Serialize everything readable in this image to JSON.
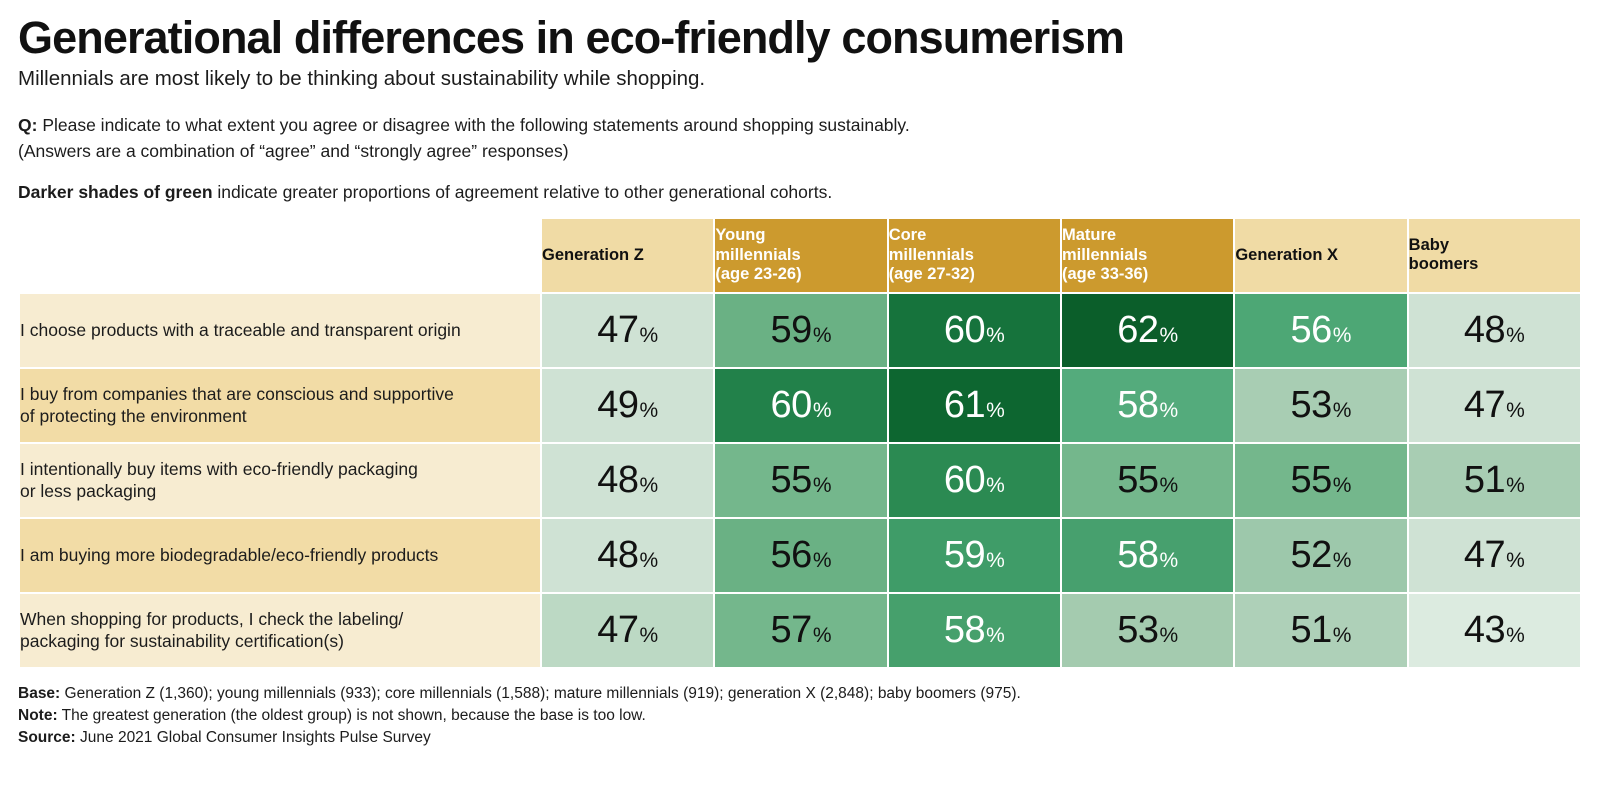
{
  "header": {
    "title": "Generational differences in eco-friendly consumerism",
    "subtitle": "Millennials are most likely to be thinking about sustainability while shopping.",
    "question_label": "Q:",
    "question_text": " Please indicate to what extent you agree or disagree with the following statements around shopping sustainably.",
    "question_note": "(Answers are a combination of “agree” and “strongly agree” responses)",
    "legend_bold": "Darker shades of green",
    "legend_rest": " indicate greater proportions of agreement relative to other generational cohorts."
  },
  "footer": {
    "base_label": "Base:",
    "base_text": " Generation Z (1,360); young millennials (933); core millennials (1,588); mature millennials (919); generation X (2,848); baby boomers (975).",
    "note_label": "Note:",
    "note_text": " The greatest generation (the oldest group) is not shown, because the base is too low.",
    "source_label": "Source:",
    "source_text": " June 2021 Global Consumer Insights Pulse Survey"
  },
  "colors": {
    "header_cream": "#f0dba5",
    "header_gold": "#cc9a2e",
    "label_odd": "#f7ecd1",
    "label_even": "#f2dca6",
    "green_1": "#dfeade",
    "green_2": "#cfe2d4",
    "green_3": "#bcd9c4",
    "green_4": "#a8cdb3",
    "green_5": "#8cc1a0",
    "green_6": "#6ab184",
    "green_7": "#46a06c",
    "green_8": "#2b8a52",
    "green_9": "#16733c",
    "green_10": "#0b5e2a"
  },
  "chart_data": {
    "type": "heatmap",
    "title": "Generational differences in eco-friendly consumerism",
    "subtitle": "Millennials are most likely to be thinking about sustainability while shopping.",
    "xlabel": "",
    "ylabel": "",
    "unit": "%",
    "legend": "Darker shades of green indicate greater proportions of agreement relative to other generational cohorts.",
    "categories": [
      {
        "line1": "Generation Z",
        "line2": "",
        "line3": "",
        "style": "cream"
      },
      {
        "line1": "Young",
        "line2": "millennials",
        "line3": "(age 23-26)",
        "style": "gold"
      },
      {
        "line1": "Core",
        "line2": "millennials",
        "line3": "(age 27-32)",
        "style": "gold"
      },
      {
        "line1": "Mature",
        "line2": "millennials",
        "line3": "(age 33-36)",
        "style": "gold"
      },
      {
        "line1": "Generation X",
        "line2": "",
        "line3": "",
        "style": "cream"
      },
      {
        "line1": "Baby",
        "line2": "boomers",
        "line3": "",
        "style": "cream"
      }
    ],
    "rows": [
      {
        "label": "I choose products with a traceable and transparent origin",
        "label_line2": "",
        "values": [
          47,
          59,
          60,
          62,
          56,
          48
        ],
        "cells": [
          {
            "value": "47",
            "pct": "%",
            "bg": "#cfe2d4",
            "fg": "#111111"
          },
          {
            "value": "59",
            "pct": "%",
            "bg": "#6ab184",
            "fg": "#111111"
          },
          {
            "value": "60",
            "pct": "%",
            "bg": "#16733c",
            "fg": "#ffffff"
          },
          {
            "value": "62",
            "pct": "%",
            "bg": "#0b5e2a",
            "fg": "#ffffff"
          },
          {
            "value": "56",
            "pct": "%",
            "bg": "#4da775",
            "fg": "#ffffff"
          },
          {
            "value": "48",
            "pct": "%",
            "bg": "#cfe2d4",
            "fg": "#111111"
          }
        ]
      },
      {
        "label": "I buy from companies that are conscious and supportive",
        "label_line2": "of protecting the environment",
        "values": [
          49,
          60,
          61,
          58,
          53,
          47
        ],
        "cells": [
          {
            "value": "49",
            "pct": "%",
            "bg": "#cfe2d4",
            "fg": "#111111"
          },
          {
            "value": "60",
            "pct": "%",
            "bg": "#22814a",
            "fg": "#ffffff"
          },
          {
            "value": "61",
            "pct": "%",
            "bg": "#0d6630",
            "fg": "#ffffff"
          },
          {
            "value": "58",
            "pct": "%",
            "bg": "#54ab7c",
            "fg": "#ffffff"
          },
          {
            "value": "53",
            "pct": "%",
            "bg": "#a8cdb3",
            "fg": "#111111"
          },
          {
            "value": "47",
            "pct": "%",
            "bg": "#cfe2d4",
            "fg": "#111111"
          }
        ]
      },
      {
        "label": "I intentionally buy items with eco-friendly packaging",
        "label_line2": "or less packaging",
        "values": [
          48,
          55,
          60,
          55,
          55,
          51
        ],
        "cells": [
          {
            "value": "48",
            "pct": "%",
            "bg": "#cfe2d4",
            "fg": "#111111"
          },
          {
            "value": "55",
            "pct": "%",
            "bg": "#74b78c",
            "fg": "#111111"
          },
          {
            "value": "60",
            "pct": "%",
            "bg": "#2b8a52",
            "fg": "#ffffff"
          },
          {
            "value": "55",
            "pct": "%",
            "bg": "#74b78c",
            "fg": "#111111"
          },
          {
            "value": "55",
            "pct": "%",
            "bg": "#74b78c",
            "fg": "#111111"
          },
          {
            "value": "51",
            "pct": "%",
            "bg": "#a8cdb3",
            "fg": "#111111"
          }
        ]
      },
      {
        "label": "I am buying more biodegradable/eco-friendly products",
        "label_line2": "",
        "values": [
          48,
          56,
          59,
          58,
          52,
          47
        ],
        "cells": [
          {
            "value": "48",
            "pct": "%",
            "bg": "#cfe2d4",
            "fg": "#111111"
          },
          {
            "value": "56",
            "pct": "%",
            "bg": "#6ab184",
            "fg": "#111111"
          },
          {
            "value": "59",
            "pct": "%",
            "bg": "#3f9c68",
            "fg": "#ffffff"
          },
          {
            "value": "58",
            "pct": "%",
            "bg": "#47a06e",
            "fg": "#ffffff"
          },
          {
            "value": "52",
            "pct": "%",
            "bg": "#9dc8ab",
            "fg": "#111111"
          },
          {
            "value": "47",
            "pct": "%",
            "bg": "#cfe2d4",
            "fg": "#111111"
          }
        ]
      },
      {
        "label": "When shopping for products, I check the labeling/",
        "label_line2": "packaging for sustainability certification(s)",
        "values": [
          47,
          57,
          58,
          53,
          51,
          43
        ],
        "cells": [
          {
            "value": "47",
            "pct": "%",
            "bg": "#bcd9c4",
            "fg": "#111111"
          },
          {
            "value": "57",
            "pct": "%",
            "bg": "#74b78c",
            "fg": "#111111"
          },
          {
            "value": "58",
            "pct": "%",
            "bg": "#46a06c",
            "fg": "#ffffff"
          },
          {
            "value": "53",
            "pct": "%",
            "bg": "#a4cbaf",
            "fg": "#111111"
          },
          {
            "value": "51",
            "pct": "%",
            "bg": "#aed0b8",
            "fg": "#111111"
          },
          {
            "value": "43",
            "pct": "%",
            "bg": "#dcebe0",
            "fg": "#111111"
          }
        ]
      }
    ]
  }
}
